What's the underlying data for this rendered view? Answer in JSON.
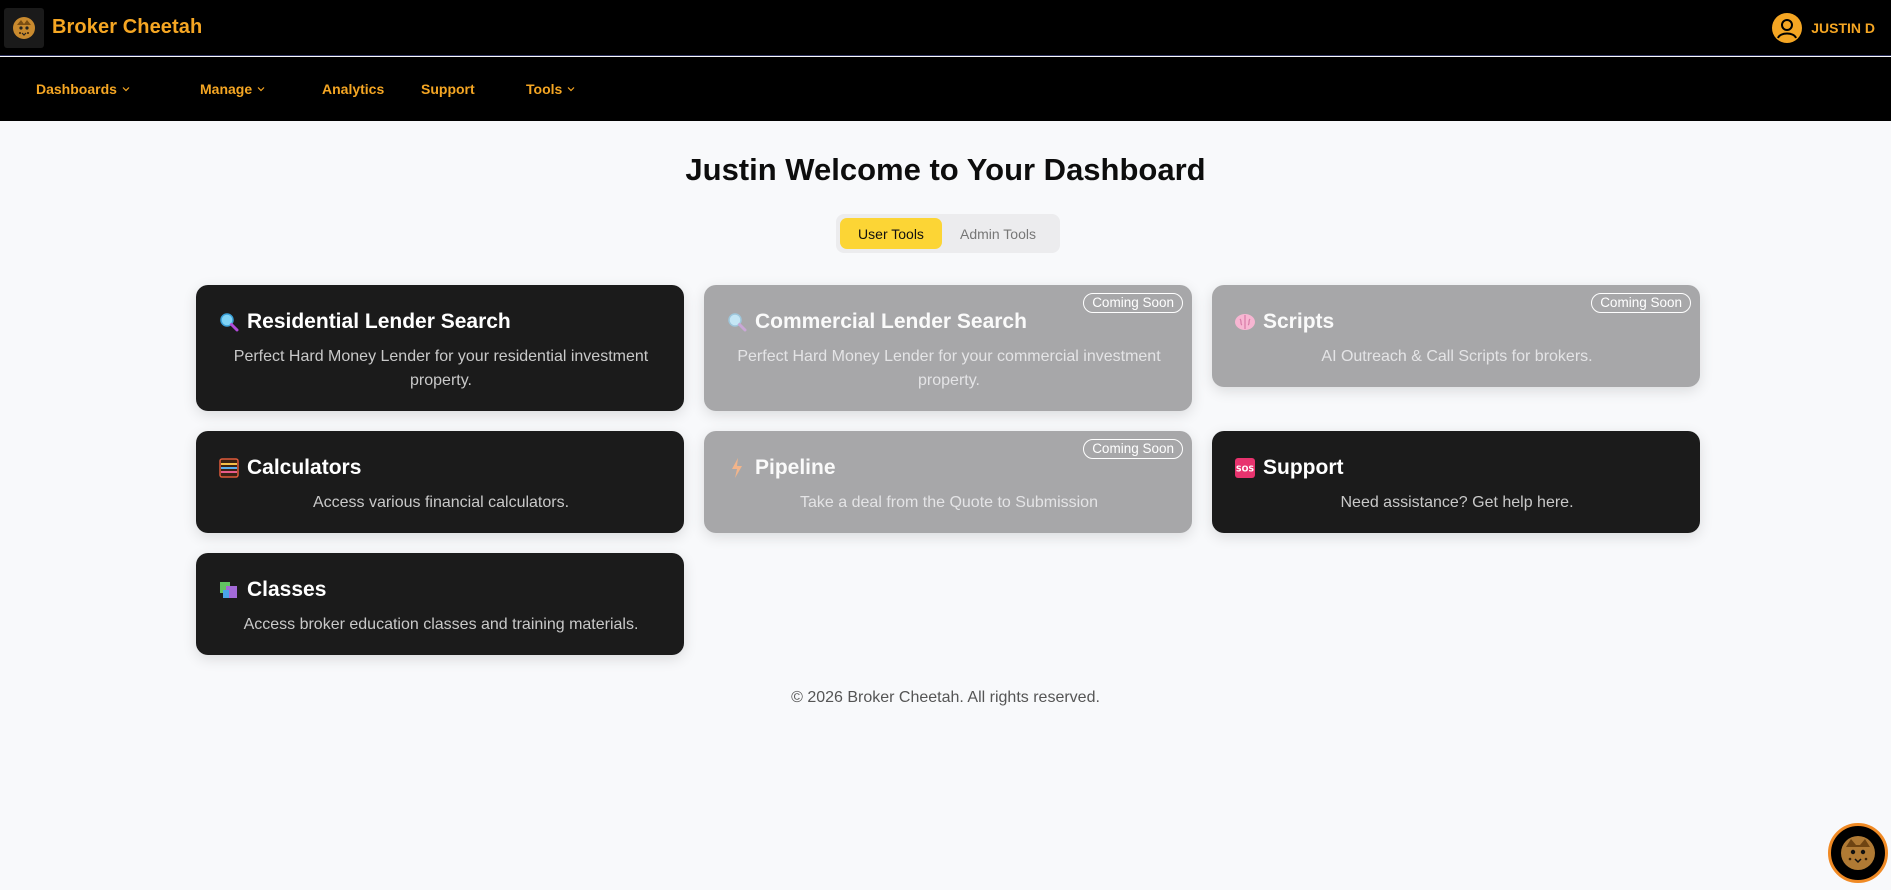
{
  "header": {
    "brand_name": "Broker Cheetah",
    "logo_icon": "cheetah-logo-icon",
    "user_name": "JUSTIN D",
    "user_icon": "user-circle-icon",
    "brand_color": "#f5a623"
  },
  "nav": {
    "items": [
      {
        "label": "Dashboards",
        "has_dropdown": true
      },
      {
        "label": "Manage",
        "has_dropdown": true
      },
      {
        "label": "Analytics",
        "has_dropdown": false
      },
      {
        "label": "Support",
        "has_dropdown": false
      },
      {
        "label": "Tools",
        "has_dropdown": true
      }
    ]
  },
  "main": {
    "title": "Justin Welcome to Your Dashboard",
    "tabs": [
      {
        "label": "User Tools",
        "active": true
      },
      {
        "label": "Admin Tools",
        "active": false
      }
    ],
    "cards": [
      {
        "title": "Residential Lender Search",
        "description": "Perfect Hard Money Lender for your residential investment property.",
        "icon": "magnifier-icon",
        "badge": "",
        "disabled": false
      },
      {
        "title": "Commercial Lender Search",
        "description": "Perfect Hard Money Lender for your commercial investment property.",
        "icon": "magnifier-icon",
        "badge": "Coming Soon",
        "disabled": true
      },
      {
        "title": "Scripts",
        "description": "AI Outreach & Call Scripts for brokers.",
        "icon": "brain-icon",
        "badge": "Coming Soon",
        "disabled": true
      },
      {
        "title": "Calculators",
        "description": "Access various financial calculators.",
        "icon": "abacus-icon",
        "badge": "",
        "disabled": false
      },
      {
        "title": "Pipeline",
        "description": "Take a deal from the Quote to Submission",
        "icon": "lightning-icon",
        "badge": "Coming Soon",
        "disabled": true
      },
      {
        "title": "Support",
        "description": "Need assistance? Get help here.",
        "icon": "sos-icon",
        "badge": "",
        "disabled": false
      },
      {
        "title": "Classes",
        "description": "Access broker education classes and training materials.",
        "icon": "books-icon",
        "badge": "",
        "disabled": false
      }
    ]
  },
  "footer": {
    "text": "© 2026 Broker Cheetah. All rights reserved."
  },
  "fab": {
    "icon": "cheetah-chat-icon",
    "ring_color": "#f08a24"
  },
  "colors": {
    "accent": "#f5a623",
    "active_tab": "#fcd535",
    "card_dark": "#1b1b1b",
    "card_disabled": "#a7a7a9"
  }
}
